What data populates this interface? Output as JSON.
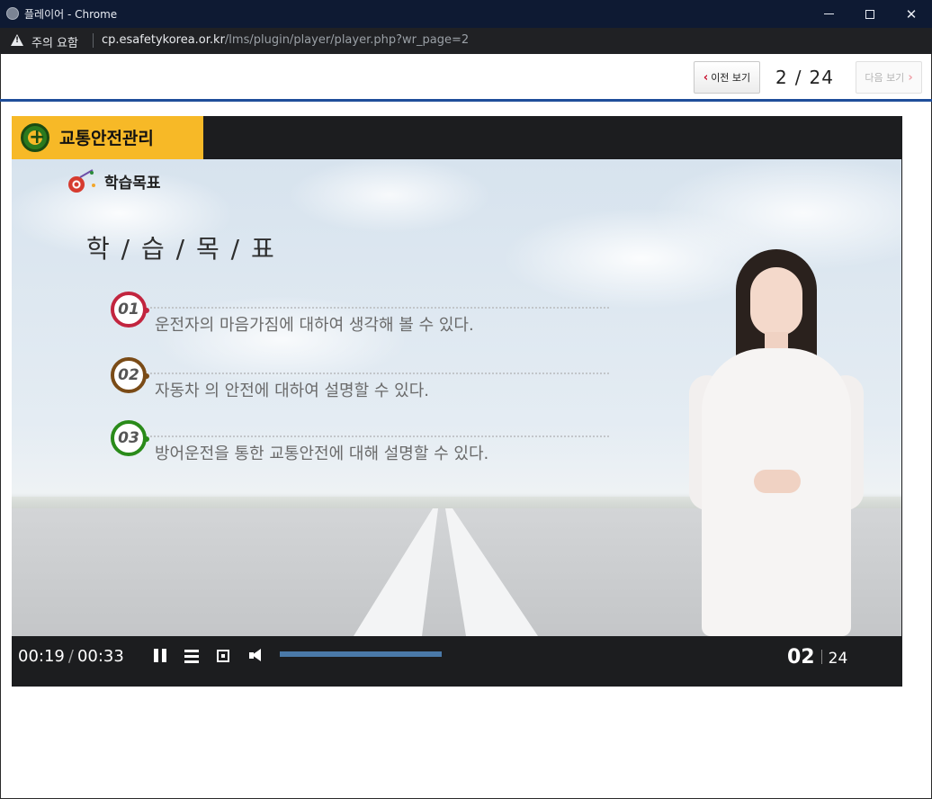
{
  "window": {
    "title": "플레이어 - Chrome"
  },
  "address_bar": {
    "security_label": "주의 요함",
    "host": "cp.esafetykorea.or.kr",
    "path": "/lms/plugin/player/player.php?wr_page=2"
  },
  "page_nav": {
    "prev_label": "이전 보기",
    "next_label": "다음 보기",
    "current_page": "2",
    "separator": "/",
    "total_pages": "24"
  },
  "course": {
    "title": "교통안전관리"
  },
  "slide": {
    "section_label": "학습목표",
    "heading": "학 / 습 / 목 / 표",
    "objectives": [
      {
        "number": "01",
        "text": "운전자의 마음가짐에 대하여 생각해 볼 수 있다."
      },
      {
        "number": "02",
        "text": "자동차 의 안전에 대하여 설명할 수 있다."
      },
      {
        "number": "03",
        "text": "방어운전을 통한 교통안전에 대해 설명할 수 있다."
      }
    ]
  },
  "player": {
    "current_time": "00:19",
    "time_separator": "/",
    "duration": "00:33",
    "progress_fraction": 1.0,
    "slide_current": "02",
    "slide_total": "24"
  },
  "colors": {
    "accent_yellow": "#f7b927",
    "nav_rule_blue": "#1f4e9a",
    "badge_01": "#c2253f",
    "badge_02": "#7a4b17",
    "badge_03": "#2a8b1a",
    "progress_fill": "#4a79a8"
  },
  "icons": [
    "globe-icon",
    "minimize-icon",
    "maximize-icon",
    "close-icon",
    "warning-icon",
    "chevron-left-icon",
    "chevron-right-icon",
    "plus-circle-icon",
    "target-icon",
    "pause-icon",
    "menu-icon",
    "fullscreen-icon",
    "volume-icon"
  ]
}
